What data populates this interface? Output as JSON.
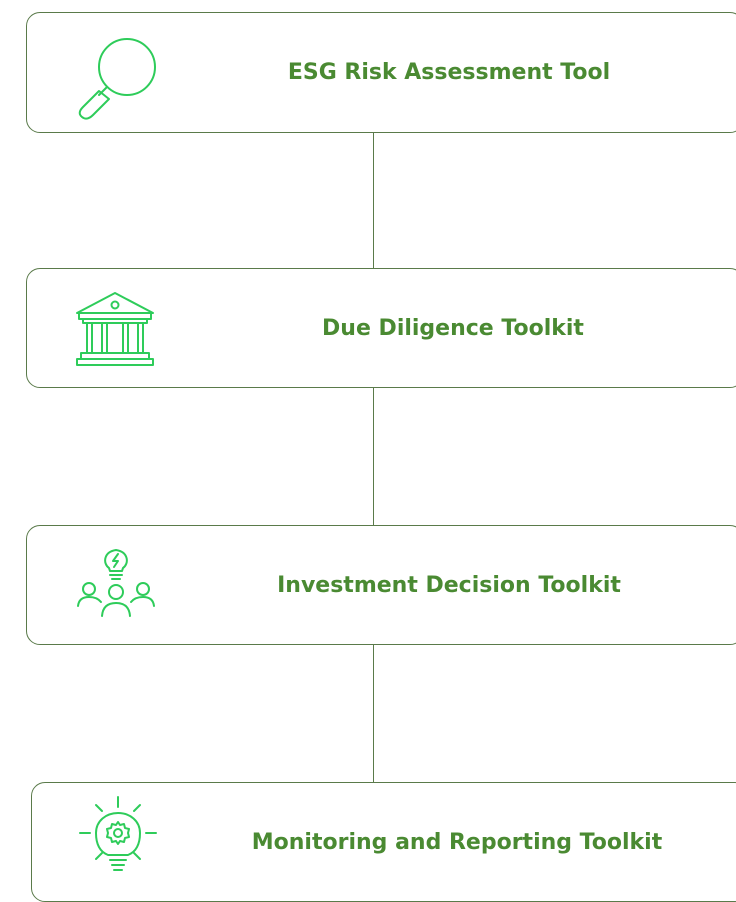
{
  "diagram": {
    "colors": {
      "accent": "#4a8a32",
      "icon": "#2ecc5a",
      "border": "#5a7a4a"
    },
    "steps": [
      {
        "label": "ESG Risk Assessment Tool",
        "icon": "magnifying-glass-icon"
      },
      {
        "label": "Due Diligence Toolkit",
        "icon": "bank-building-icon"
      },
      {
        "label": "Investment Decision Toolkit",
        "icon": "team-idea-icon"
      },
      {
        "label": "Monitoring and Reporting Toolkit",
        "icon": "lightbulb-gear-icon"
      }
    ]
  }
}
